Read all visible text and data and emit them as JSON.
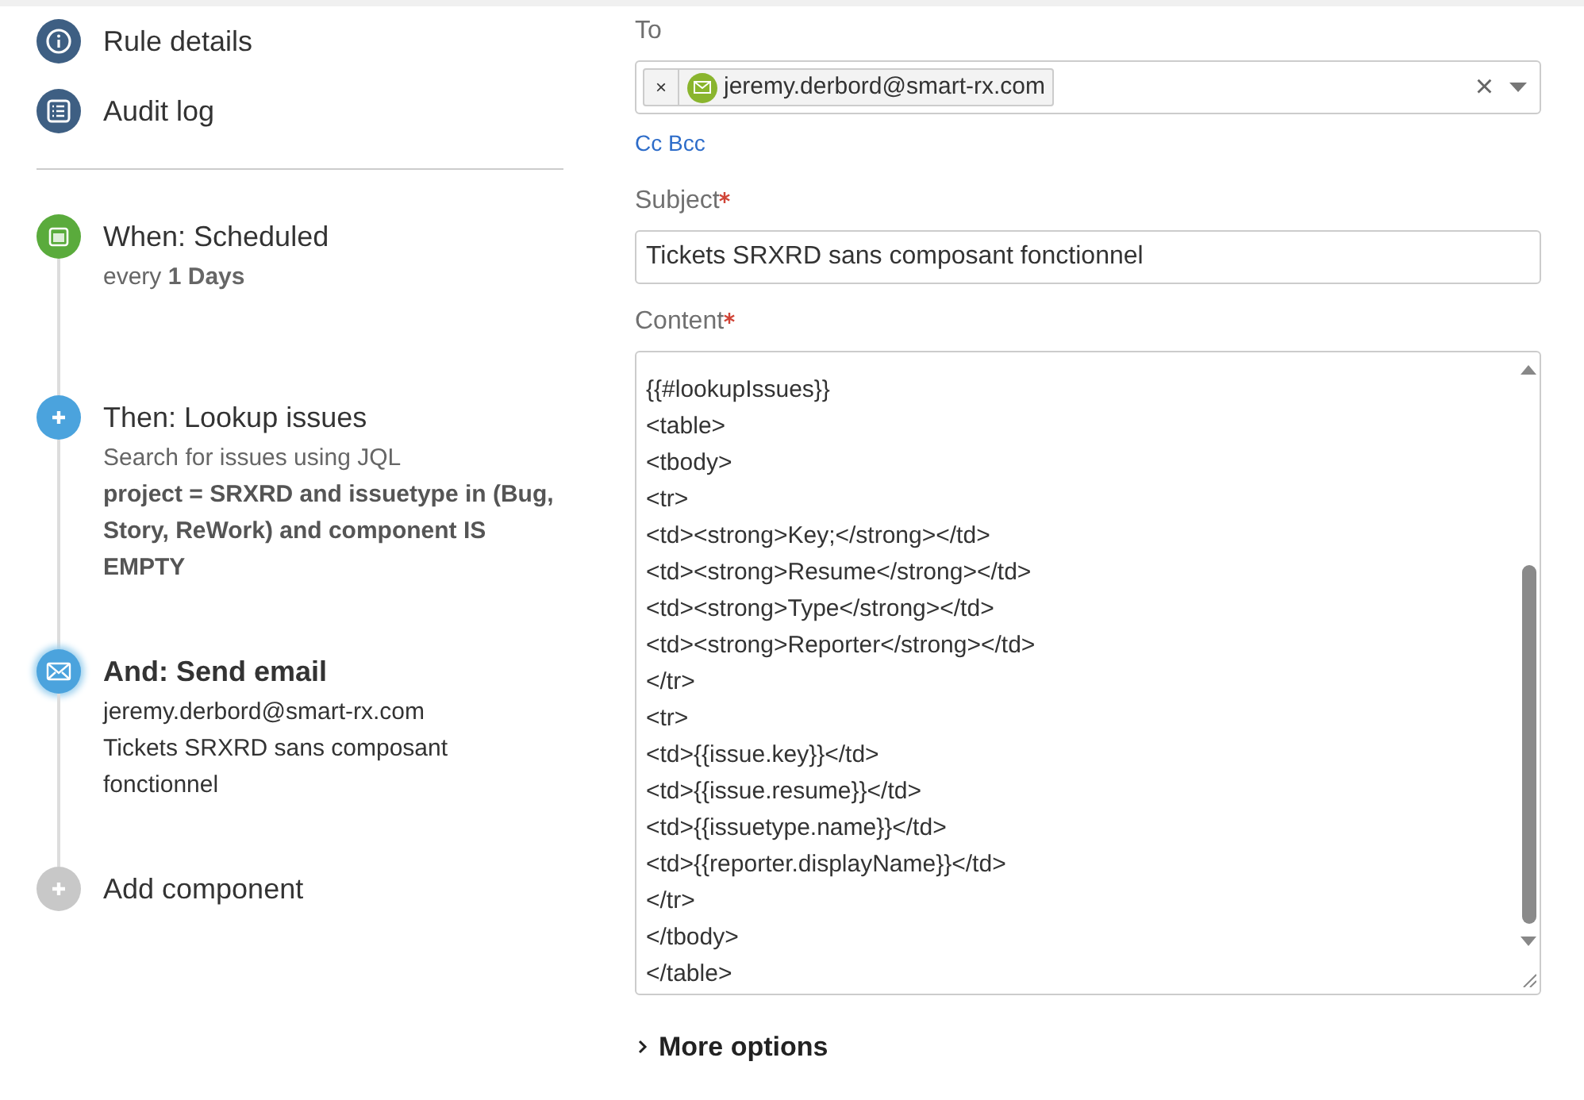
{
  "nav": [
    {
      "kind": "info",
      "label": "Rule details"
    },
    {
      "kind": "log",
      "label": "Audit log"
    }
  ],
  "steps": [
    {
      "kind": "trigger",
      "title": "When: Scheduled",
      "selected": false,
      "details": [
        {
          "kind": "note",
          "text": "every **1 Days**"
        }
      ]
    },
    {
      "kind": "action",
      "title": "Then: Lookup issues",
      "selected": false,
      "details": [
        {
          "kind": "note",
          "text": "Search for issues using JQL"
        },
        {
          "kind": "query",
          "text": "project = SRXRD and issuetype in (Bug, Story, ReWork) and component IS EMPTY"
        }
      ]
    },
    {
      "kind": "email",
      "title": "And: Send email",
      "selected": true,
      "details": [
        {
          "kind": "value",
          "text": "jeremy.derbord@smart-rx.com"
        },
        {
          "kind": "value",
          "text": "Tickets SRXRD sans composant fonctionnel"
        }
      ]
    },
    {
      "kind": "add",
      "title": "Add component",
      "selected": false
    }
  ],
  "form": {
    "to": {
      "label": "To",
      "recipients": [
        {
          "email": "jeremy.derbord@smart-rx.com"
        }
      ],
      "remove_glyph": "×",
      "clear_glyph": "×",
      "cc_bcc": "Cc Bcc"
    },
    "subject": {
      "label": "Subject",
      "required": true,
      "value": "Tickets SRXRD sans composant fonctionnel"
    },
    "content": {
      "label": "Content",
      "required": true,
      "lines": [
        "{{#lookupIssues}}",
        "<table>",
        "<tbody>",
        "<tr>",
        "<td><strong>Key;</strong></td>",
        "<td><strong>Resume</strong></td>",
        "<td><strong>Type</strong></td>",
        "<td><strong>Reporter</strong></td>",
        "</tr>",
        "<tr>",
        "<td>{{issue.key}}</td>",
        "<td>{{issue.resume}}</td>",
        "<td>{{issuetype.name}}</td>",
        "<td>{{reporter.displayName}}</td>",
        "</tr>",
        "</tbody>",
        "</table>"
      ]
    },
    "more_options": {
      "label": "More options",
      "expanded": false
    }
  }
}
